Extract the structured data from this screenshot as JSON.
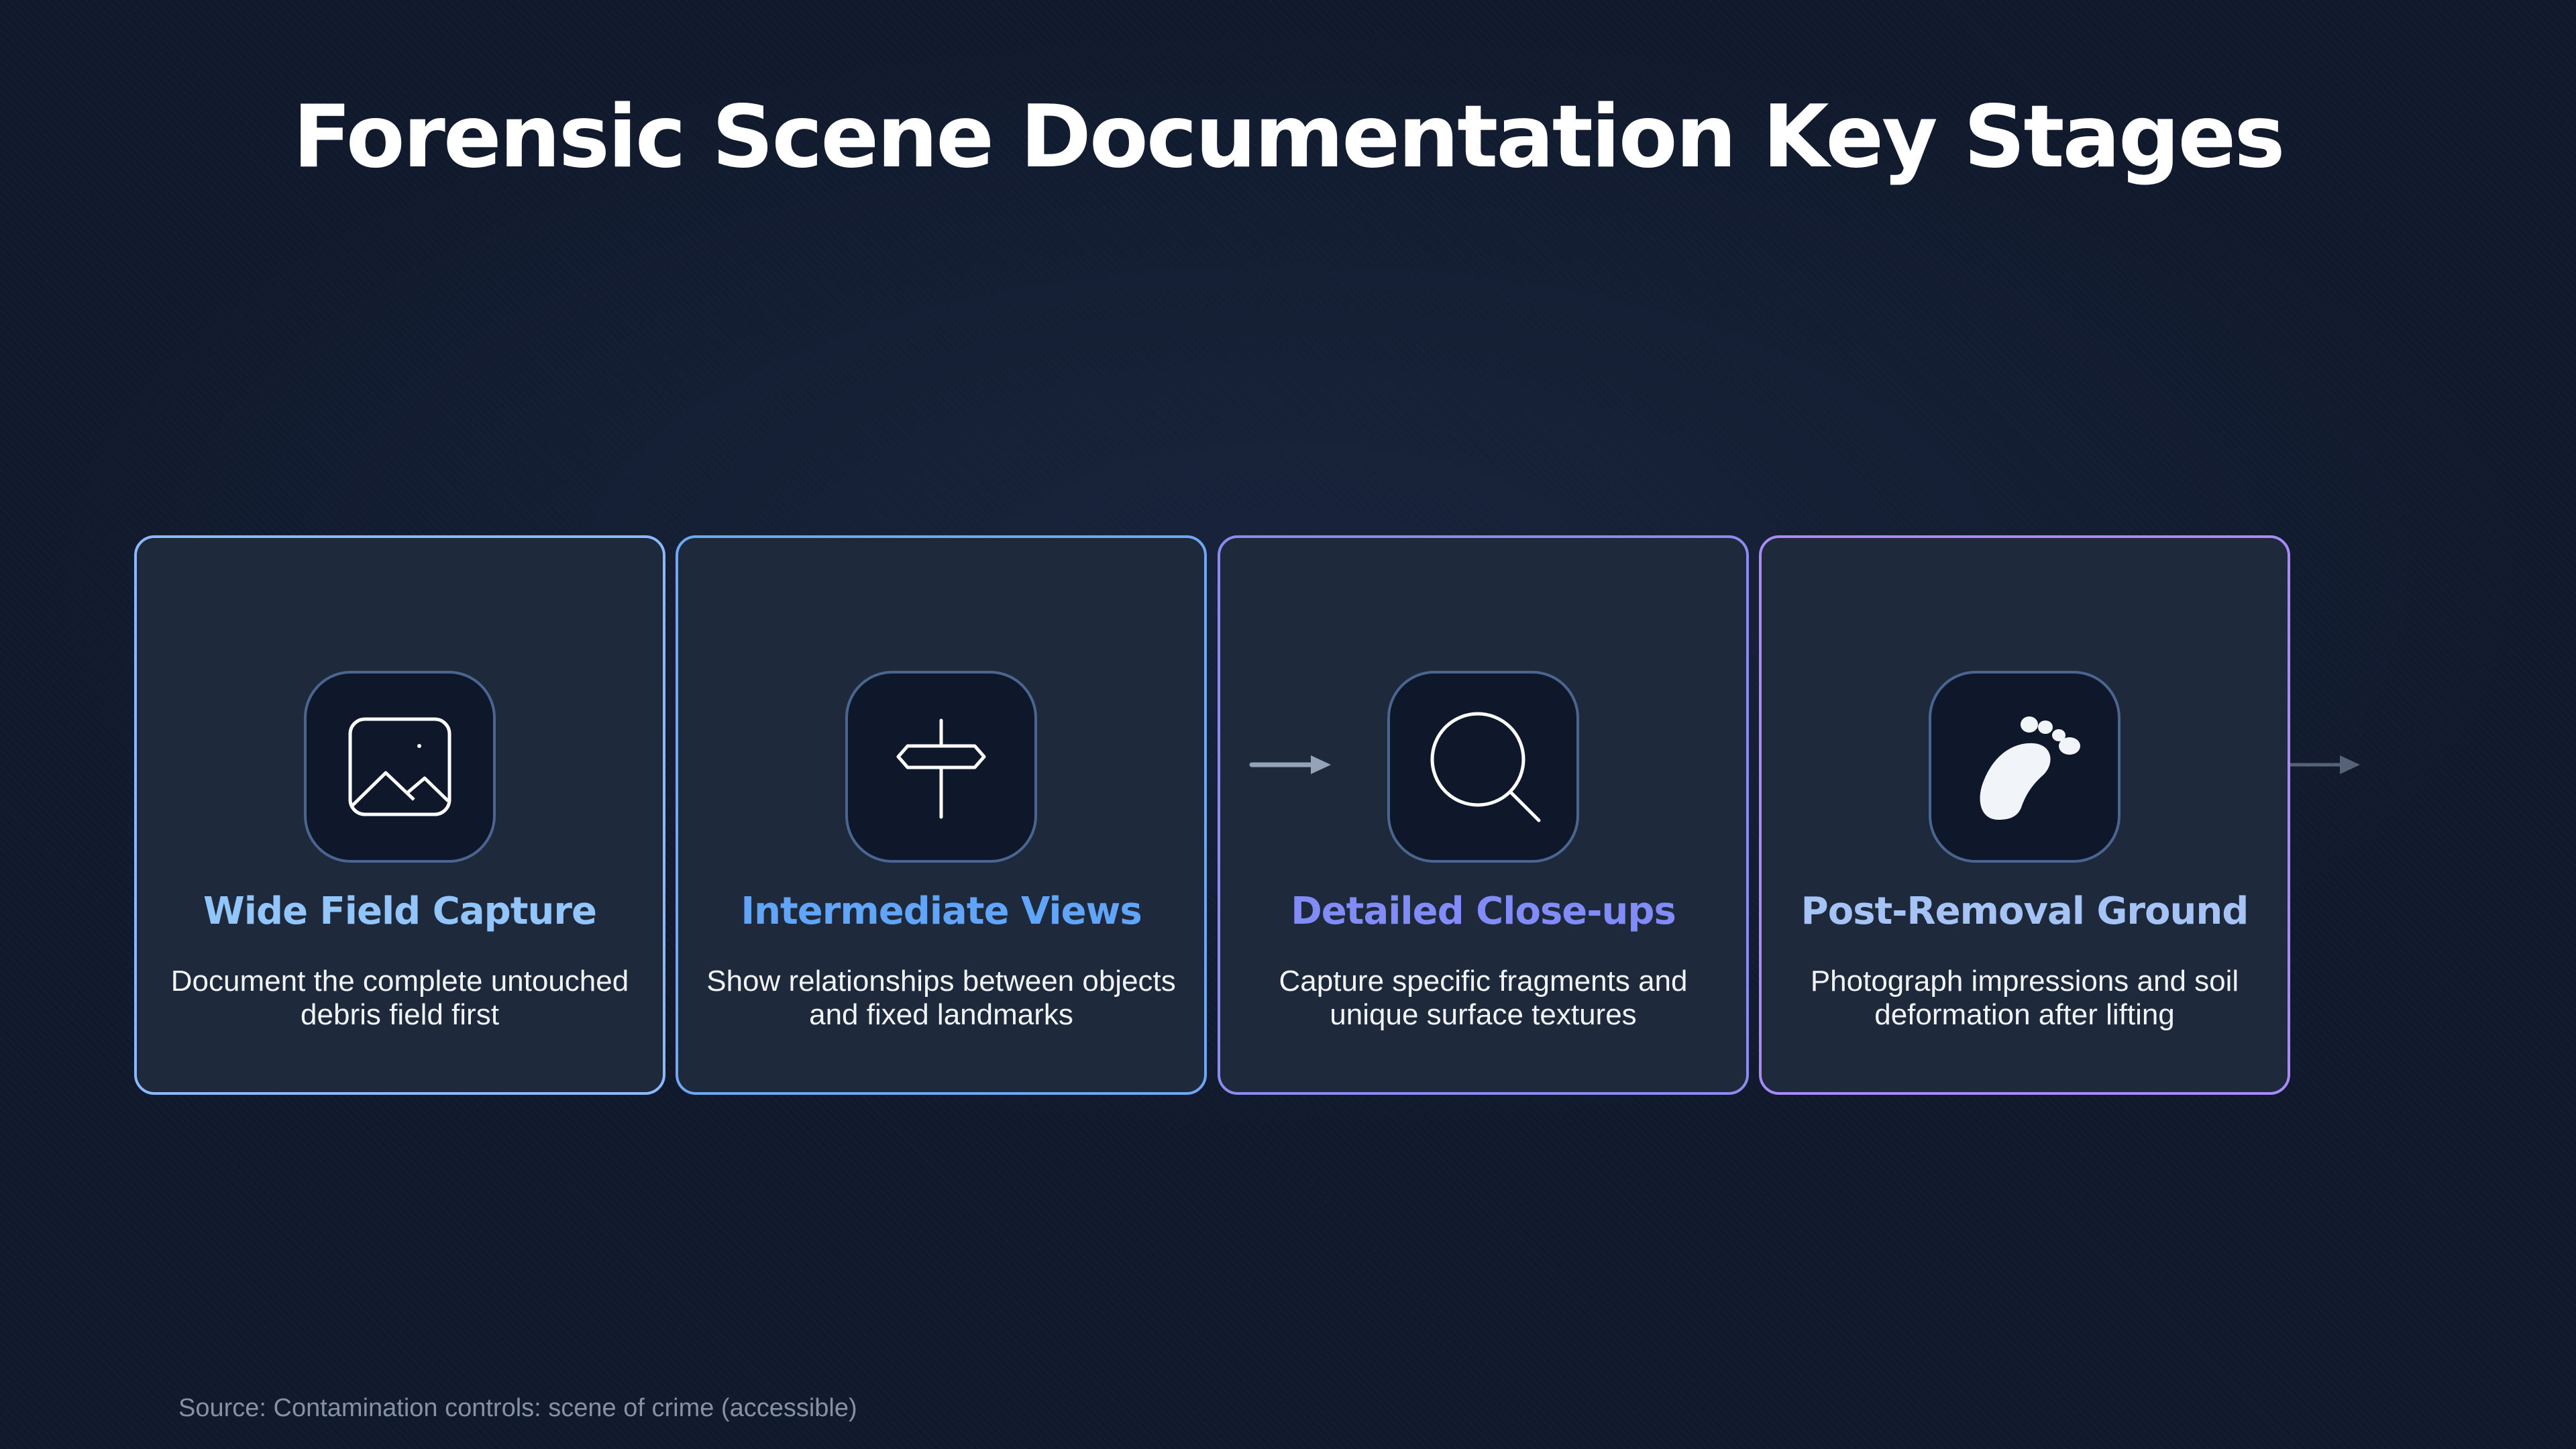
{
  "title": "Forensic Scene Documentation Key Stages",
  "stages": [
    {
      "title": "Wide Field Capture",
      "description": "Document the complete untouched debris field first",
      "icon": "image-icon",
      "title_color": "#93c5fd",
      "border_color": "#8db8ff"
    },
    {
      "title": "Intermediate Views",
      "description": "Show relationships between objects and fixed landmarks",
      "icon": "signpost-icon",
      "title_color": "#60a5fa",
      "border_color": "#6ea8f5"
    },
    {
      "title": "Detailed Close-ups",
      "description": "Capture specific fragments and unique surface textures",
      "icon": "search-icon",
      "title_color": "#818cf8",
      "border_color": "#8b8bf0"
    },
    {
      "title": "Post-Removal Ground",
      "description": "Photograph impressions and soil deformation after lifting",
      "icon": "footprint-icon",
      "title_color": "#a5c4f5",
      "border_color": "#a78bfa"
    }
  ],
  "source": "Source: Contamination controls: scene of crime (accessible)",
  "colors": {
    "background": "#111a2d",
    "card_background": "#1e293c",
    "icon_background": "#0f172a",
    "arrow": "#94a3b8"
  }
}
